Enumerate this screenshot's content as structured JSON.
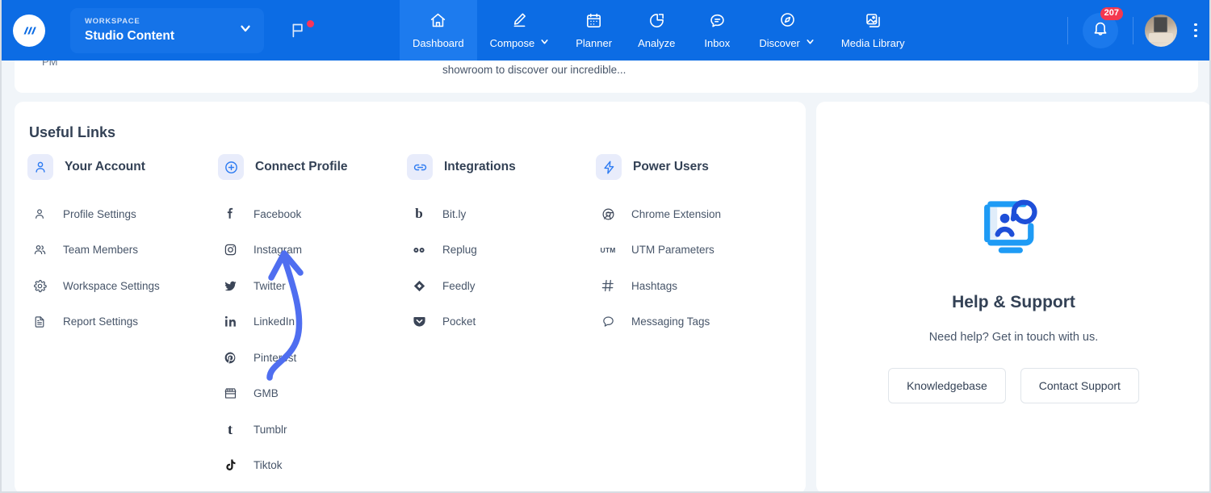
{
  "topnav": {
    "logo_icon": "contentstudio-logo-icon",
    "workspace": {
      "label": "WORKSPACE",
      "name": "Studio Content",
      "chevron_icon": "chevron-down-icon"
    },
    "flag_icon": "flag-icon",
    "items": [
      {
        "label": "Dashboard",
        "icon": "home-icon",
        "active": true,
        "has_chevron": false
      },
      {
        "label": "Compose",
        "icon": "pencil-icon",
        "active": false,
        "has_chevron": true
      },
      {
        "label": "Planner",
        "icon": "calendar-icon",
        "active": false,
        "has_chevron": false
      },
      {
        "label": "Analyze",
        "icon": "pie-chart-icon",
        "active": false,
        "has_chevron": false
      },
      {
        "label": "Inbox",
        "icon": "message-icon",
        "active": false,
        "has_chevron": false
      },
      {
        "label": "Discover",
        "icon": "compass-icon",
        "active": false,
        "has_chevron": true
      },
      {
        "label": "Media Library",
        "icon": "image-stack-icon",
        "active": false,
        "has_chevron": false
      }
    ],
    "notifications": {
      "icon": "bell-icon",
      "badge_count": "207",
      "badge_color": "#f4384f"
    },
    "avatar_icon": "user-avatar",
    "menu_icon": "kebab-menu-icon",
    "background_color": "#0c6ce4"
  },
  "topcard": {
    "time_fragment": "PM",
    "post_text_fragment": "showroom to discover our incredible..."
  },
  "useful_links": {
    "title": "Useful Links",
    "columns": [
      {
        "header": "Your Account",
        "header_icon": "user-icon",
        "items": [
          {
            "label": "Profile Settings",
            "icon": "user-icon"
          },
          {
            "label": "Team Members",
            "icon": "users-icon"
          },
          {
            "label": "Workspace Settings",
            "icon": "gear-icon"
          },
          {
            "label": "Report Settings",
            "icon": "document-icon"
          }
        ]
      },
      {
        "header": "Connect Profile",
        "header_icon": "plus-circle-icon",
        "items": [
          {
            "label": "Facebook",
            "icon": "facebook-icon"
          },
          {
            "label": "Instagram",
            "icon": "instagram-icon"
          },
          {
            "label": "Twitter",
            "icon": "twitter-icon"
          },
          {
            "label": "LinkedIn",
            "icon": "linkedin-icon"
          },
          {
            "label": "Pinterest",
            "icon": "pinterest-icon"
          },
          {
            "label": "GMB",
            "icon": "storefront-icon"
          },
          {
            "label": "Tumblr",
            "icon": "tumblr-icon"
          },
          {
            "label": "Tiktok",
            "icon": "tiktok-icon"
          }
        ]
      },
      {
        "header": "Integrations",
        "header_icon": "link-icon",
        "items": [
          {
            "label": "Bit.ly",
            "icon": "bitly-icon"
          },
          {
            "label": "Replug",
            "icon": "replug-icon"
          },
          {
            "label": "Feedly",
            "icon": "feedly-icon"
          },
          {
            "label": "Pocket",
            "icon": "pocket-icon"
          }
        ]
      },
      {
        "header": "Power Users",
        "header_icon": "lightning-bolt-icon",
        "items": [
          {
            "label": "Chrome Extension",
            "icon": "chrome-icon"
          },
          {
            "label": "UTM Parameters",
            "icon": "utm-icon"
          },
          {
            "label": "Hashtags",
            "icon": "hashtag-icon"
          },
          {
            "label": "Messaging Tags",
            "icon": "chat-bubble-icon"
          }
        ]
      }
    ]
  },
  "help_panel": {
    "illustration_icon": "customer-support-icon",
    "title": "Help & Support",
    "subtitle": "Need help? Get in touch with us.",
    "buttons": [
      {
        "label": "Knowledgebase"
      },
      {
        "label": "Contact Support"
      }
    ]
  },
  "annotation": {
    "arrow_icon": "curved-arrow-annotation",
    "arrow_color": "#4f6ef0",
    "points_to": "Instagram"
  }
}
